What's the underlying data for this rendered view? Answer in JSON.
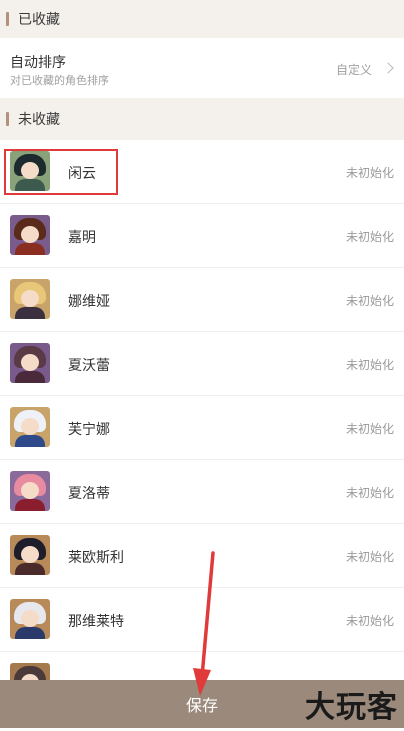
{
  "sections": {
    "favorited_title": "已收藏",
    "unfavorited_title": "未收藏"
  },
  "sort": {
    "title": "自动排序",
    "subtitle": "对已收藏的角色排序",
    "value": "自定义"
  },
  "characters": [
    {
      "name": "闲云",
      "status": "未初始化",
      "colors": {
        "bg": "#8aa27a",
        "hair": "#1d2a2e",
        "body": "#3d5a4e"
      }
    },
    {
      "name": "嘉明",
      "status": "未初始化",
      "colors": {
        "bg": "#7a5c8c",
        "hair": "#5a2a1a",
        "body": "#8a2e22"
      }
    },
    {
      "name": "娜维娅",
      "status": "未初始化",
      "colors": {
        "bg": "#c9a46a",
        "hair": "#e8c878",
        "body": "#3a3040"
      }
    },
    {
      "name": "夏沃蕾",
      "status": "未初始化",
      "colors": {
        "bg": "#7a5a8c",
        "hair": "#5a3a44",
        "body": "#4a2a3a"
      }
    },
    {
      "name": "芙宁娜",
      "status": "未初始化",
      "colors": {
        "bg": "#c9a46a",
        "hair": "#eef1f8",
        "body": "#2e4a8a"
      }
    },
    {
      "name": "夏洛蒂",
      "status": "未初始化",
      "colors": {
        "bg": "#8a6a9a",
        "hair": "#e88aa0",
        "body": "#8a1e2e"
      }
    },
    {
      "name": "莱欧斯利",
      "status": "未初始化",
      "colors": {
        "bg": "#b88a5a",
        "hair": "#1e1e2a",
        "body": "#4a2a2a"
      }
    },
    {
      "name": "那维莱特",
      "status": "未初始化",
      "colors": {
        "bg": "#b88a5a",
        "hair": "#e6e8ee",
        "body": "#2a3a6a"
      }
    },
    {
      "name": "",
      "status": "",
      "colors": {
        "bg": "#a57a4e",
        "hair": "#4a3a3a",
        "body": "#5a2a2a"
      }
    }
  ],
  "save_label": "保存",
  "watermark": "大玩客",
  "colors": {
    "section_bg": "#f4f1ec",
    "accent_bar": "#b3917a",
    "save_bar": "#9b8a7c",
    "annotation": "#e03a3a"
  }
}
